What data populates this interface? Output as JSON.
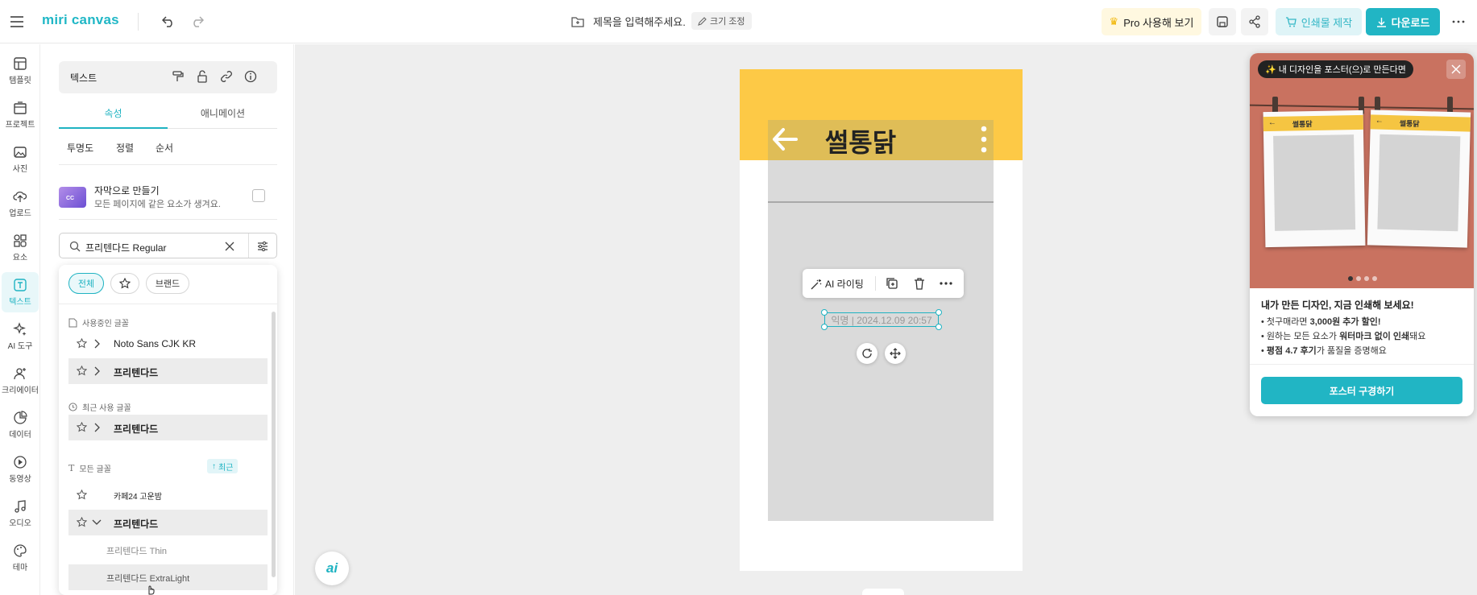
{
  "app": {
    "logo": "miri canvas",
    "title_placeholder": "제목을 입력해주세요.",
    "resize_label": "크기 조정",
    "pro_label": "Pro 사용해 보기",
    "print_label": "인쇄물 제작",
    "download_label": "다운로드"
  },
  "rail": {
    "items": [
      {
        "label": "템플릿",
        "icon": "template-icon"
      },
      {
        "label": "프로젝트",
        "icon": "project-icon"
      },
      {
        "label": "사진",
        "icon": "photo-icon"
      },
      {
        "label": "업로드",
        "icon": "upload-icon"
      },
      {
        "label": "요소",
        "icon": "elements-icon"
      },
      {
        "label": "텍스트",
        "icon": "text-icon"
      },
      {
        "label": "AI 도구",
        "icon": "ai-tools-icon"
      },
      {
        "label": "크리에이터",
        "icon": "creator-icon"
      },
      {
        "label": "데이터",
        "icon": "data-icon"
      },
      {
        "label": "동영상",
        "icon": "video-icon"
      },
      {
        "label": "오디오",
        "icon": "audio-icon"
      },
      {
        "label": "테마",
        "icon": "theme-icon"
      }
    ]
  },
  "panel": {
    "header_label": "텍스트",
    "tabs": [
      "속성",
      "애니메이션"
    ],
    "subtabs": [
      "투명도",
      "정렬",
      "순서"
    ],
    "caption_title": "자막으로 만들기",
    "caption_desc": "모든 페이지에 같은 요소가 생겨요.",
    "caption_thumb": "CC",
    "search_value": "프리텐다드 Regular",
    "chips": [
      "전체",
      "브랜드"
    ],
    "section_used": "사용중인 글꼴",
    "section_recent": "최근 사용 글꼴",
    "section_all": "모든 글꼴",
    "recent_sort": "최근",
    "fonts": {
      "noto": "Noto Sans CJK KR",
      "pretendard_used": "프리텐다드",
      "pretendard_recent": "프리텐다드",
      "cafe24": "카페24 고운밤",
      "pretendard_all": "프리텐다드",
      "thin": "프리텐다드 Thin",
      "extralight": "프리텐다드 ExtraLight"
    }
  },
  "canvas": {
    "page_title": "썰통닭",
    "date_text": "익명  |  2024.12.09 20:57",
    "ai_writing": "AI 라이팅",
    "ai_fab": "ai"
  },
  "promo": {
    "tag": "✨ 내 디자인을 포스터(으)로 만든다면",
    "poster_title": "썰통닭",
    "headline": "내가 만든 디자인, 지금 인쇄해 보세요!",
    "bullet1_pre": "첫구매라면 ",
    "bullet1_bold": "3,000원 추가 할인!",
    "bullet2_pre": "원하는 모든 요소가 ",
    "bullet2_bold": "워터마크 없이 인쇄",
    "bullet2_post": "돼요",
    "bullet3_bold": "평점 4.7 후기",
    "bullet3_post": "가 품질을 증명해요",
    "button": "포스터 구경하기"
  },
  "colors": {
    "accent": "#21b5c4",
    "yellow": "#fdc946",
    "pro_bg": "#fff8e0"
  }
}
